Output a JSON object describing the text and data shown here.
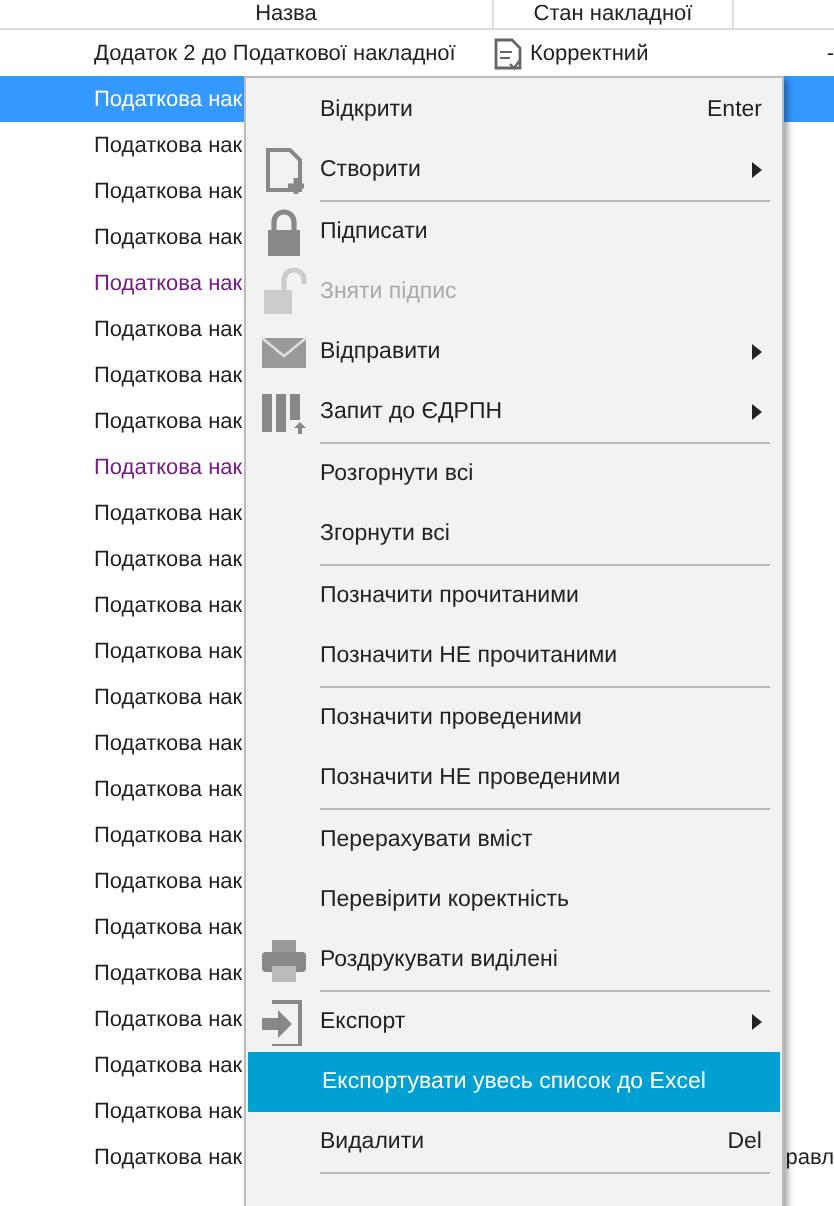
{
  "table": {
    "columns": [
      "Назва",
      "Стан накладної"
    ],
    "rows": [
      {
        "name": "Додаток 2 до Податкової накладної",
        "state": "Корректний",
        "column_4": "-",
        "selected": false,
        "color": "#222222"
      },
      {
        "name": "Податкова нак",
        "selected": true,
        "color": "#ffffff"
      },
      {
        "name": "Податкова нак",
        "selected": false,
        "color": "#222222"
      },
      {
        "name": "Податкова нак",
        "selected": false,
        "color": "#222222"
      },
      {
        "name": "Податкова нак",
        "selected": false,
        "color": "#222222"
      },
      {
        "name": "Податкова нак",
        "selected": false,
        "color": "#7a1a8a"
      },
      {
        "name": "Податкова нак",
        "selected": false,
        "color": "#222222"
      },
      {
        "name": "Податкова нак",
        "selected": false,
        "color": "#222222"
      },
      {
        "name": "Податкова нак",
        "selected": false,
        "color": "#222222"
      },
      {
        "name": "Податкова нак",
        "selected": false,
        "color": "#7a1a8a"
      },
      {
        "name": "Податкова нак",
        "selected": false,
        "color": "#222222"
      },
      {
        "name": "Податкова нак",
        "selected": false,
        "color": "#222222"
      },
      {
        "name": "Податкова нак",
        "selected": false,
        "color": "#222222"
      },
      {
        "name": "Податкова нак",
        "selected": false,
        "color": "#222222"
      },
      {
        "name": "Податкова нак",
        "selected": false,
        "color": "#222222"
      },
      {
        "name": "Податкова нак",
        "selected": false,
        "color": "#222222"
      },
      {
        "name": "Податкова нак",
        "selected": false,
        "color": "#222222"
      },
      {
        "name": "Податкова нак",
        "selected": false,
        "color": "#222222"
      },
      {
        "name": "Податкова нак",
        "selected": false,
        "color": "#222222"
      },
      {
        "name": "Податкова нак",
        "selected": false,
        "color": "#222222"
      },
      {
        "name": "Податкова нак",
        "selected": false,
        "color": "#222222"
      },
      {
        "name": "Податкова нак",
        "selected": false,
        "color": "#222222"
      },
      {
        "name": "Податкова нак",
        "selected": false,
        "color": "#222222"
      },
      {
        "name": "Податкова нак",
        "selected": false,
        "color": "#222222"
      },
      {
        "name": "Податкова нак",
        "column_4": "равл",
        "selected": false,
        "color": "#222222"
      }
    ]
  },
  "context_menu": {
    "items": [
      {
        "kind": "item",
        "label": "Відкрити",
        "shortcut": "Enter",
        "submenu": false,
        "disabled": false,
        "selected": false
      },
      {
        "kind": "newdoc",
        "label": "Створити",
        "submenu": true,
        "disabled": false,
        "selected": false
      },
      {
        "kind": "separator"
      },
      {
        "kind": "lock",
        "label": "Підписати",
        "submenu": false,
        "disabled": false,
        "selected": false
      },
      {
        "kind": "unlock",
        "label": "Зняти підпис",
        "submenu": false,
        "disabled": true,
        "selected": false
      },
      {
        "kind": "envelope",
        "label": "Відправити",
        "submenu": true,
        "disabled": false,
        "selected": false
      },
      {
        "kind": "columns",
        "label": "Запит до ЄДРПН",
        "submenu": true,
        "disabled": false,
        "selected": false
      },
      {
        "kind": "separator"
      },
      {
        "kind": "item",
        "label": "Розгорнути всі",
        "submenu": false,
        "disabled": false,
        "selected": false
      },
      {
        "kind": "item",
        "label": "Згорнути всі",
        "submenu": false,
        "disabled": false,
        "selected": false
      },
      {
        "kind": "separator"
      },
      {
        "kind": "item",
        "label": "Позначити прочитаними",
        "submenu": false,
        "disabled": false,
        "selected": false
      },
      {
        "kind": "item",
        "label": "Позначити НЕ прочитаними",
        "submenu": false,
        "disabled": false,
        "selected": false
      },
      {
        "kind": "separator"
      },
      {
        "kind": "item",
        "label": "Позначити проведеними",
        "submenu": false,
        "disabled": false,
        "selected": false
      },
      {
        "kind": "item",
        "label": "Позначити НЕ проведеними",
        "submenu": false,
        "disabled": false,
        "selected": false
      },
      {
        "kind": "separator"
      },
      {
        "kind": "item",
        "label": "Перерахувати вміст",
        "submenu": false,
        "disabled": false,
        "selected": false
      },
      {
        "kind": "item",
        "label": "Перевірити коректність",
        "submenu": false,
        "disabled": false,
        "selected": false
      },
      {
        "kind": "printer",
        "label": "Роздрукувати виділені",
        "submenu": false,
        "disabled": false,
        "selected": false
      },
      {
        "kind": "separator"
      },
      {
        "kind": "export",
        "label": "Експорт",
        "submenu": true,
        "disabled": false,
        "selected": false
      },
      {
        "kind": "item",
        "label": "Експортувати увесь список до Excel",
        "submenu": false,
        "disabled": false,
        "selected": true
      },
      {
        "kind": "item",
        "label": "Видалити",
        "shortcut": "Del",
        "submenu": false,
        "disabled": false,
        "selected": false
      },
      {
        "kind": "separator"
      }
    ]
  }
}
